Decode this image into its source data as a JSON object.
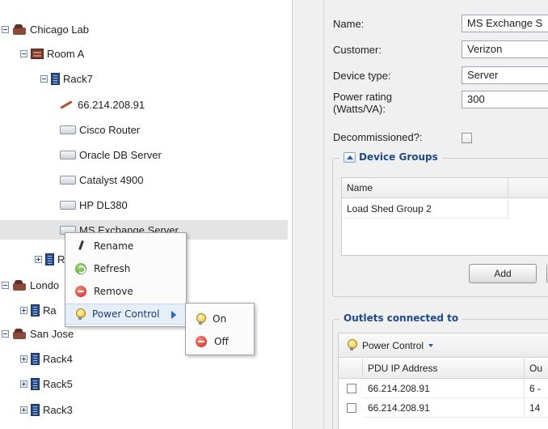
{
  "tree": {
    "items": [
      {
        "label": "Chicago Lab",
        "type": "site",
        "expander": "minus"
      },
      {
        "label": "Room A",
        "type": "room",
        "expander": "minus"
      },
      {
        "label": "Rack7",
        "type": "rack",
        "expander": "minus"
      },
      {
        "label": "66.214.208.91",
        "type": "pdu",
        "expander": "none"
      },
      {
        "label": "Cisco Router",
        "type": "device",
        "expander": "none"
      },
      {
        "label": "Oracle DB Server",
        "type": "device",
        "expander": "none"
      },
      {
        "label": "Catalyst 4900",
        "type": "device",
        "expander": "none"
      },
      {
        "label": "HP DL380",
        "type": "device",
        "expander": "none"
      },
      {
        "label": "MS Exchange Server",
        "type": "device",
        "expander": "none",
        "selected": true
      },
      {
        "label": "R",
        "type": "rack",
        "expander": "plus"
      },
      {
        "label": "Londo",
        "type": "site",
        "expander": "minus"
      },
      {
        "label": "Ra",
        "type": "rack",
        "expander": "plus"
      },
      {
        "label": "San Jose",
        "type": "site",
        "expander": "minus"
      },
      {
        "label": "Rack4",
        "type": "rack",
        "expander": "plus"
      },
      {
        "label": "Rack5",
        "type": "rack",
        "expander": "plus"
      },
      {
        "label": "Rack3",
        "type": "rack",
        "expander": "plus"
      }
    ]
  },
  "context_menu": {
    "items": [
      {
        "label": "Rename",
        "icon": "pencil-icon"
      },
      {
        "label": "Refresh",
        "icon": "refresh-icon"
      },
      {
        "label": "Remove",
        "icon": "remove-icon"
      },
      {
        "label": "Power Control",
        "icon": "bulb-icon",
        "has_submenu": true
      }
    ],
    "submenu": [
      {
        "label": "On",
        "icon": "bulb-icon"
      },
      {
        "label": "Off",
        "icon": "remove-icon"
      }
    ]
  },
  "form": {
    "name_label": "Name:",
    "name_value": "MS Exchange S",
    "customer_label": "Customer:",
    "customer_value": "Verizon",
    "device_type_label": "Device type:",
    "device_type_value": "Server",
    "power_rating_label_1": "Power rating",
    "power_rating_label_2": "(Watts/VA):",
    "power_rating_value": "300",
    "decommissioned_label": "Decommissioned?:",
    "decommissioned_checked": false
  },
  "device_groups": {
    "title": "Device Groups",
    "column_name": "Name",
    "rows": [
      "Load Shed Group 2"
    ],
    "add_button": "Add"
  },
  "outlets": {
    "title": "Outlets connected to",
    "toolbar_label": "Power Control",
    "columns": [
      "PDU IP Address",
      "Ou"
    ],
    "rows": [
      {
        "ip": "66.214.208.91",
        "outlet": "6 -"
      },
      {
        "ip": "66.214.208.91",
        "outlet": "14"
      }
    ]
  },
  "colors": {
    "accent": "#1f4a8a",
    "selected_row": "#e4e4e4"
  }
}
